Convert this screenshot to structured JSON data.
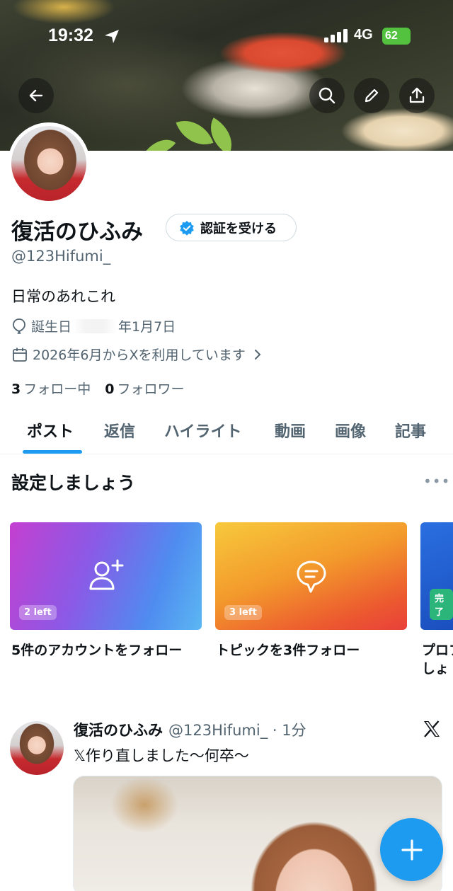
{
  "status_bar": {
    "time": "19:32",
    "network": "4G",
    "battery": "62"
  },
  "header_icons": [
    "back-arrow-icon",
    "search-icon",
    "pencil-icon",
    "share-icon"
  ],
  "profile": {
    "name": "復活のひふみ",
    "verify_label": "認証を受ける",
    "handle": "@123Hifumi_",
    "bio": "日常のあれこれ",
    "birthday_prefix": "誕生日",
    "birthday_value": "年1月7日",
    "joined": "2026年6月からXを利用しています",
    "following_count": "3",
    "following_label": "フォロー中",
    "followers_count": "0",
    "followers_label": "フォロワー"
  },
  "tabs": [
    {
      "label": "ポスト"
    },
    {
      "label": "返信"
    },
    {
      "label": "ハイライト"
    },
    {
      "label": "動画"
    },
    {
      "label": "画像"
    },
    {
      "label": "記事"
    }
  ],
  "setup": {
    "title": "設定しましょう",
    "cards": [
      {
        "badge": "2 left",
        "label": "5件のアカウントをフォロー",
        "icon": "add-user-icon"
      },
      {
        "badge": "3 left",
        "label": "トピックを3件フォロー",
        "icon": "chat-bubble-icon"
      },
      {
        "badge": "完了",
        "label": "プロフ",
        "label2": "しょ"
      }
    ]
  },
  "post": {
    "name": "復活のひふみ",
    "meta": "@123Hifumi_ · 1分",
    "text": "𝕏作り直しました〜何卒〜"
  },
  "colors": {
    "accent": "#1d9bf0",
    "secondary_text": "#536471"
  }
}
